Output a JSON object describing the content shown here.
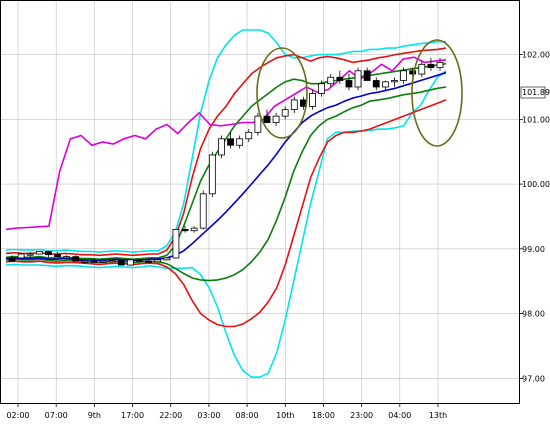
{
  "chart_data": {
    "type": "line",
    "title": "",
    "xlabel": "",
    "ylabel": "",
    "x_ticks": [
      "02:00",
      "07:00",
      "9th",
      "17:00",
      "22:00",
      "03:00",
      "08:00",
      "10th",
      "18:00",
      "23:00",
      "04:00",
      "13th"
    ],
    "y_ticks": [
      "102.00",
      "101.00",
      "100.00",
      "99.00",
      "98.00",
      "97.00"
    ],
    "ylim": [
      96.82,
      102.38
    ],
    "grid": true,
    "current_price_label": "101.89",
    "bands": [
      {
        "name": "",
        "color": "#00e5ee",
        "values": [
          98.75,
          98.76,
          98.75,
          98.75,
          98.75,
          98.74,
          98.73,
          98.74,
          98.74,
          98.73,
          98.72,
          98.71,
          98.72,
          98.73,
          98.72,
          98.71,
          98.72,
          98.74,
          98.72,
          98.7,
          98.7,
          98.7,
          98.71,
          98.6,
          98.4,
          98.1,
          97.7,
          97.35,
          97.12,
          97.02,
          97.02,
          97.08,
          97.4,
          97.9,
          98.5,
          99.1,
          99.7,
          100.2,
          100.7,
          100.8,
          100.8,
          100.82,
          100.82,
          100.83,
          100.85,
          100.85,
          100.87,
          100.9,
          101.1,
          101.22,
          101.45,
          101.65,
          101.75
        ]
      },
      {
        "name": "",
        "color": "#00e5ee",
        "values": [
          98.98,
          98.99,
          98.98,
          98.98,
          98.99,
          98.97,
          98.97,
          98.98,
          98.97,
          98.96,
          98.96,
          98.95,
          98.96,
          98.97,
          98.96,
          98.95,
          98.96,
          98.97,
          98.97,
          99.05,
          99.25,
          99.7,
          100.4,
          101.1,
          101.6,
          101.95,
          102.15,
          102.3,
          102.38,
          102.38,
          102.38,
          102.33,
          102.18,
          102.0,
          101.95,
          101.95,
          101.98,
          102.0,
          102.0,
          102.0,
          102.02,
          102.05,
          102.05,
          102.08,
          102.08,
          102.1,
          102.1,
          102.13,
          102.15,
          102.17,
          102.18,
          102.2,
          102.2
        ]
      },
      {
        "name": "",
        "color": "#e81010",
        "values": [
          98.8,
          98.81,
          98.8,
          98.8,
          98.81,
          98.79,
          98.78,
          98.79,
          98.79,
          98.78,
          98.77,
          98.76,
          98.77,
          98.78,
          98.77,
          98.76,
          98.77,
          98.78,
          98.77,
          98.72,
          98.62,
          98.45,
          98.2,
          98.0,
          97.9,
          97.83,
          97.8,
          97.8,
          97.84,
          97.92,
          98.02,
          98.18,
          98.4,
          98.75,
          99.2,
          99.65,
          100.1,
          100.4,
          100.65,
          100.75,
          100.8,
          100.8,
          100.82,
          100.85,
          100.9,
          100.95,
          101.0,
          101.05,
          101.1,
          101.15,
          101.2,
          101.25,
          101.3
        ]
      },
      {
        "name": "",
        "color": "#e81010",
        "values": [
          98.93,
          98.94,
          98.93,
          98.93,
          98.94,
          98.92,
          98.92,
          98.93,
          98.92,
          98.91,
          98.91,
          98.9,
          98.91,
          98.92,
          98.91,
          98.9,
          98.91,
          98.92,
          98.92,
          98.98,
          99.18,
          99.55,
          100.1,
          100.55,
          100.85,
          101.05,
          101.2,
          101.4,
          101.55,
          101.7,
          101.8,
          101.88,
          101.95,
          101.98,
          102.0,
          101.95,
          101.9,
          101.95,
          101.97,
          101.95,
          101.92,
          101.88,
          101.9,
          101.92,
          101.95,
          101.97,
          102.0,
          102.02,
          102.04,
          102.06,
          102.07,
          102.08,
          102.1
        ]
      },
      {
        "name": "",
        "color": "#0a7d0a",
        "values": [
          98.83,
          98.84,
          98.83,
          98.83,
          98.84,
          98.82,
          98.81,
          98.82,
          98.82,
          98.81,
          98.8,
          98.79,
          98.8,
          98.81,
          98.8,
          98.79,
          98.8,
          98.81,
          98.8,
          98.77,
          98.7,
          98.62,
          98.55,
          98.52,
          98.51,
          98.52,
          98.55,
          98.6,
          98.68,
          98.8,
          98.95,
          99.15,
          99.45,
          99.8,
          100.2,
          100.5,
          100.75,
          100.9,
          101.0,
          101.05,
          101.12,
          101.18,
          101.22,
          101.28,
          101.3,
          101.32,
          101.35,
          101.38,
          101.4,
          101.42,
          101.45,
          101.48,
          101.5
        ]
      },
      {
        "name": "",
        "color": "#0a7d0a",
        "values": [
          98.87,
          98.88,
          98.87,
          98.87,
          98.88,
          98.86,
          98.86,
          98.87,
          98.86,
          98.85,
          98.85,
          98.84,
          98.85,
          98.86,
          98.85,
          98.84,
          98.85,
          98.86,
          98.86,
          98.9,
          99.05,
          99.35,
          99.7,
          100.05,
          100.3,
          100.5,
          100.7,
          100.9,
          101.05,
          101.2,
          101.3,
          101.4,
          101.5,
          101.58,
          101.62,
          101.6,
          101.55,
          101.55,
          101.58,
          101.6,
          101.62,
          101.64,
          101.66,
          101.68,
          101.7,
          101.72,
          101.74,
          101.76,
          101.78,
          101.8,
          101.82,
          101.84,
          101.86
        ]
      }
    ],
    "series": [
      {
        "name": "",
        "color": "#0000cc",
        "values": [
          98.85,
          98.86,
          98.85,
          98.85,
          98.86,
          98.84,
          98.84,
          98.85,
          98.84,
          98.83,
          98.83,
          98.82,
          98.83,
          98.84,
          98.83,
          98.82,
          98.83,
          98.84,
          98.84,
          98.86,
          98.9,
          98.97,
          99.08,
          99.2,
          99.32,
          99.44,
          99.57,
          99.71,
          99.85,
          100.0,
          100.15,
          100.3,
          100.47,
          100.65,
          100.8,
          100.95,
          101.05,
          101.12,
          101.18,
          101.22,
          101.28,
          101.33,
          101.36,
          101.4,
          101.42,
          101.45,
          101.48,
          101.52,
          101.56,
          101.6,
          101.64,
          101.68,
          101.72
        ]
      },
      {
        "name": "",
        "color": "#dd00dd",
        "values": [
          99.3,
          99.32,
          99.33,
          99.34,
          99.35,
          100.2,
          100.7,
          100.75,
          100.6,
          100.65,
          100.62,
          100.7,
          100.75,
          100.7,
          100.85,
          100.92,
          100.78,
          100.95,
          101.1,
          100.92,
          100.9,
          100.92,
          100.95,
          100.95,
          101.0,
          101.2,
          101.3,
          101.4,
          101.5,
          101.42,
          101.46,
          101.6,
          101.75,
          101.62,
          101.72,
          101.85,
          101.75,
          101.93,
          101.96,
          101.88,
          101.9,
          101.92
        ]
      }
    ],
    "candles": [
      [
        98.86,
        98.9,
        98.85,
        98.81
      ],
      [
        98.86,
        98.92,
        98.86,
        98.92
      ],
      [
        98.92,
        98.95,
        98.85,
        98.92
      ],
      [
        98.92,
        98.94,
        98.92,
        98.96
      ],
      [
        98.96,
        98.97,
        98.87,
        98.91
      ],
      [
        98.91,
        98.95,
        98.91,
        98.88
      ],
      [
        98.88,
        98.9,
        98.84,
        98.88
      ],
      [
        98.88,
        98.9,
        98.87,
        98.81
      ],
      [
        98.81,
        98.83,
        98.77,
        98.81
      ],
      [
        98.81,
        98.85,
        98.8,
        98.8
      ],
      [
        98.8,
        98.82,
        98.78,
        98.81
      ],
      [
        98.81,
        98.84,
        98.79,
        98.82
      ],
      [
        98.82,
        98.83,
        98.77,
        98.75
      ],
      [
        98.75,
        98.79,
        98.74,
        98.83
      ],
      [
        98.83,
        98.84,
        98.79,
        98.81
      ],
      [
        98.81,
        98.84,
        98.8,
        98.8
      ],
      [
        98.8,
        98.83,
        98.8,
        98.83
      ],
      [
        98.83,
        98.84,
        98.82,
        98.86
      ],
      [
        98.86,
        98.95,
        98.85,
        99.3
      ],
      [
        99.3,
        99.35,
        99.25,
        99.28
      ],
      [
        99.28,
        99.35,
        99.25,
        99.32
      ],
      [
        99.32,
        99.9,
        99.3,
        99.85
      ],
      [
        99.85,
        100.5,
        99.8,
        100.45
      ],
      [
        100.45,
        100.75,
        100.4,
        100.7
      ],
      [
        100.7,
        100.8,
        100.55,
        100.6
      ],
      [
        100.6,
        100.75,
        100.55,
        100.7
      ],
      [
        100.7,
        100.85,
        100.65,
        100.8
      ],
      [
        100.8,
        101.1,
        100.75,
        101.05
      ],
      [
        101.05,
        101.15,
        100.95,
        100.95
      ],
      [
        100.95,
        101.1,
        100.9,
        101.05
      ],
      [
        101.05,
        101.2,
        101.0,
        101.15
      ],
      [
        101.15,
        101.35,
        101.1,
        101.3
      ],
      [
        101.3,
        101.35,
        101.15,
        101.2
      ],
      [
        101.2,
        101.45,
        101.15,
        101.4
      ],
      [
        101.4,
        101.6,
        101.35,
        101.55
      ],
      [
        101.55,
        101.7,
        101.5,
        101.65
      ],
      [
        101.65,
        101.75,
        101.55,
        101.6
      ],
      [
        101.6,
        101.7,
        101.45,
        101.5
      ],
      [
        101.5,
        101.8,
        101.45,
        101.75
      ],
      [
        101.75,
        101.8,
        101.6,
        101.6
      ],
      [
        101.6,
        101.65,
        101.45,
        101.5
      ],
      [
        101.5,
        101.6,
        101.45,
        101.58
      ],
      [
        101.58,
        101.65,
        101.5,
        101.6
      ],
      [
        101.6,
        101.8,
        101.55,
        101.75
      ],
      [
        101.75,
        101.8,
        101.65,
        101.7
      ],
      [
        101.7,
        101.9,
        101.65,
        101.85
      ],
      [
        101.85,
        101.95,
        101.75,
        101.8
      ],
      [
        101.8,
        101.95,
        101.75,
        101.88
      ]
    ],
    "annotations": [
      {
        "shape": "ellipse",
        "color": "#6b6b1a"
      },
      {
        "shape": "ellipse",
        "color": "#6b6b1a"
      }
    ]
  }
}
